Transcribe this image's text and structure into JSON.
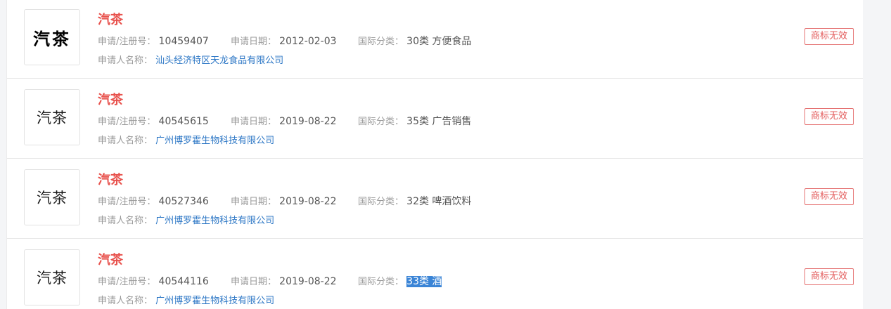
{
  "labels": {
    "reg_no": "申请/注册号：",
    "apply_date": "申请日期：",
    "intl_class": "国际分类：",
    "applicant": "申请人名称："
  },
  "items": [
    {
      "logo_text": "汽茶",
      "name": "汽茶",
      "reg_no": "10459407",
      "apply_date": "2012-02-03",
      "intl_class": "30类 方便食品",
      "applicant": "汕头经济特区天龙食品有限公司",
      "status": "商标无效"
    },
    {
      "logo_text": "汽茶",
      "name": "汽茶",
      "reg_no": "40545615",
      "apply_date": "2019-08-22",
      "intl_class": "35类 广告销售",
      "applicant": "广州博罗霍生物科技有限公司",
      "status": "商标无效"
    },
    {
      "logo_text": "汽茶",
      "name": "汽茶",
      "reg_no": "40527346",
      "apply_date": "2019-08-22",
      "intl_class": "32类 啤酒饮料",
      "applicant": "广州博罗霍生物科技有限公司",
      "status": "商标无效"
    },
    {
      "logo_text": "汽茶",
      "name": "汽茶",
      "reg_no": "40544116",
      "apply_date": "2019-08-22",
      "intl_class": "33类 酒",
      "applicant": "广州博罗霍生物科技有限公司",
      "status": "商标无效"
    }
  ],
  "colors": {
    "name": "#e8524d",
    "applicant_link": "#2b76c5",
    "status_border": "#e57373",
    "selection_highlight": "#3a84d6"
  }
}
